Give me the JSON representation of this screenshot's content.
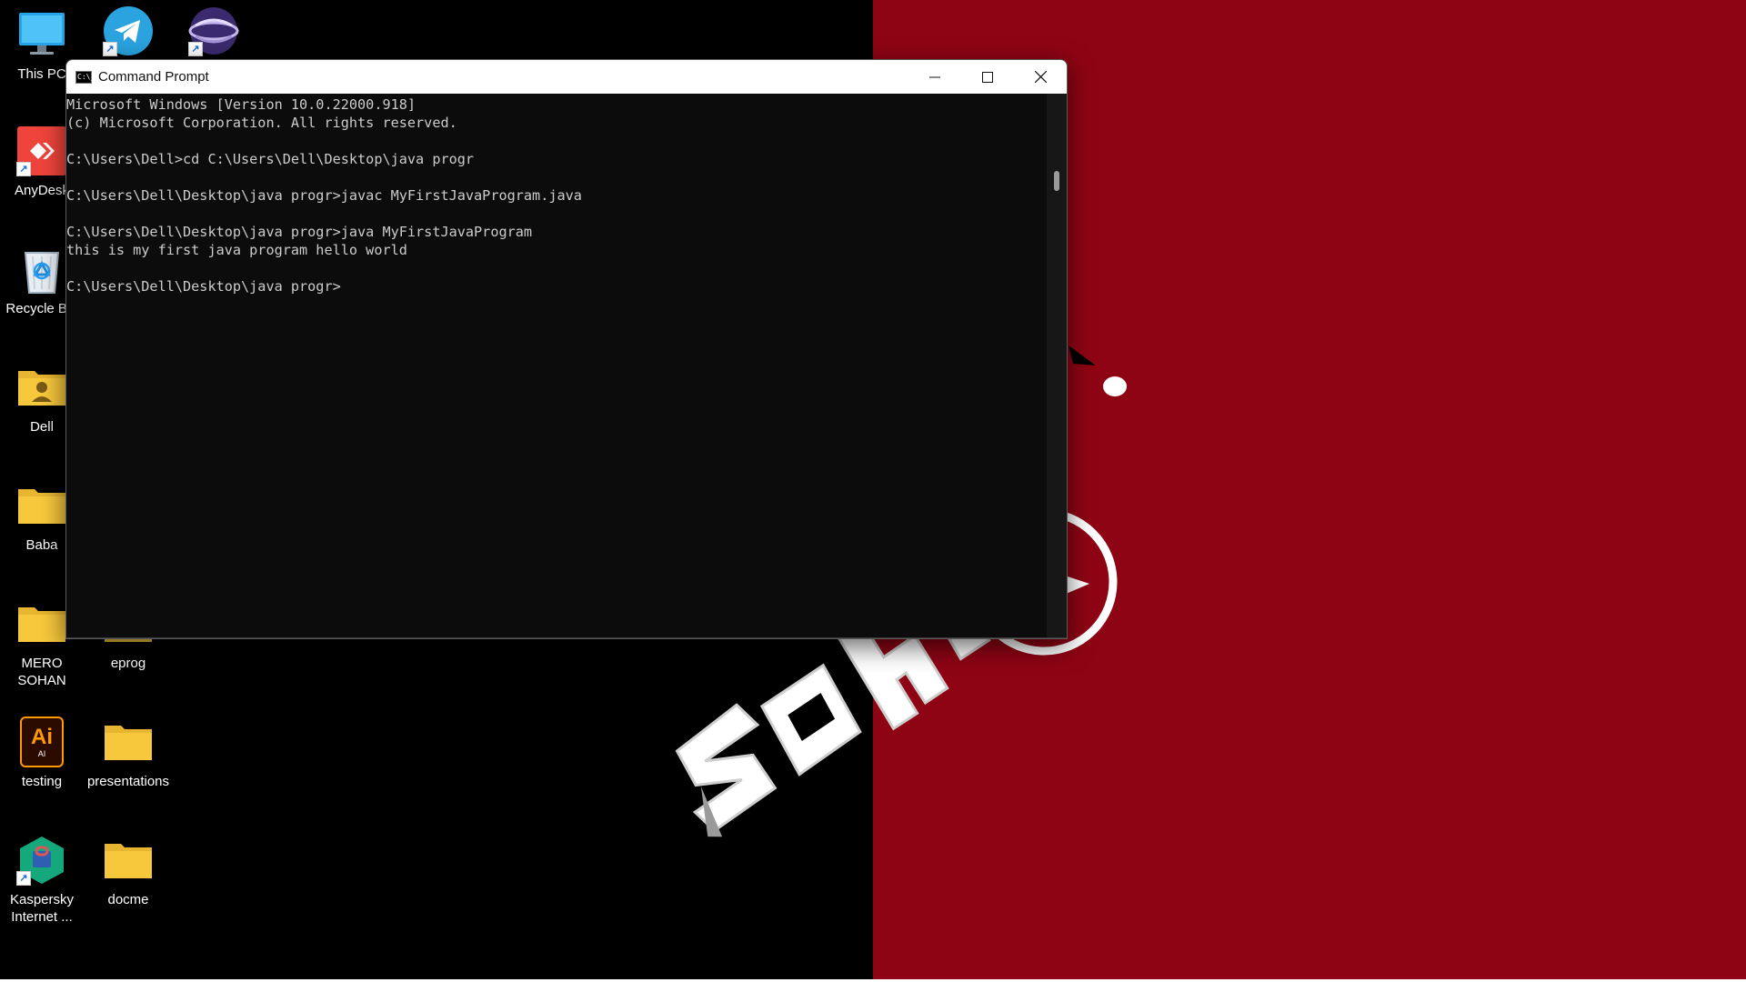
{
  "window": {
    "title": "Command Prompt",
    "icon": "cmd-icon",
    "icon_text": "C:\\_",
    "controls": [
      "minimize-icon",
      "maximize-icon",
      "close-icon"
    ]
  },
  "console": {
    "lines": [
      "Microsoft Windows [Version 10.0.22000.918]",
      "(c) Microsoft Corporation. All rights reserved.",
      "",
      "C:\\Users\\Dell>cd C:\\Users\\Dell\\Desktop\\java progr",
      "",
      "C:\\Users\\Dell\\Desktop\\java progr>javac MyFirstJavaProgram.java",
      "",
      "C:\\Users\\Dell\\Desktop\\java progr>java MyFirstJavaProgram",
      "this is my first java program hello world",
      "",
      "C:\\Users\\Dell\\Desktop\\java progr>"
    ]
  },
  "desktop": {
    "icons": [
      {
        "label": "This PC",
        "icon": "monitor-icon"
      },
      {
        "label": "",
        "icon": "telegram-icon"
      },
      {
        "label": "",
        "icon": "eclipse-icon"
      },
      {
        "label": "AnyDesk",
        "icon": "anydesk-icon"
      },
      {
        "label": "Recycle Bin",
        "icon": "recycle-bin-icon"
      },
      {
        "label": "Dell",
        "icon": "user-folder-icon"
      },
      {
        "label": "Baba",
        "icon": "folder-icon"
      },
      {
        "label": "MERO SOHAN",
        "icon": "folder-icon"
      },
      {
        "label": "eprog",
        "icon": "folder-icon"
      },
      {
        "label": "testing",
        "icon": "illustrator-icon"
      },
      {
        "label": "presentations",
        "icon": "folder-icon"
      },
      {
        "label": "Kaspersky Internet ...",
        "icon": "kaspersky-icon"
      },
      {
        "label": "docme",
        "icon": "folder-icon"
      }
    ],
    "illustrator_glyph": "Ai",
    "illustrator_sub": "AI",
    "shortcut_arrow": "↗"
  },
  "colors": {
    "wallpaper_left": "#000000",
    "wallpaper_right": "#8f0414",
    "console_bg": "#0c0c0c",
    "console_text": "#cccccc",
    "folder_yellow": "#f8c83c"
  }
}
